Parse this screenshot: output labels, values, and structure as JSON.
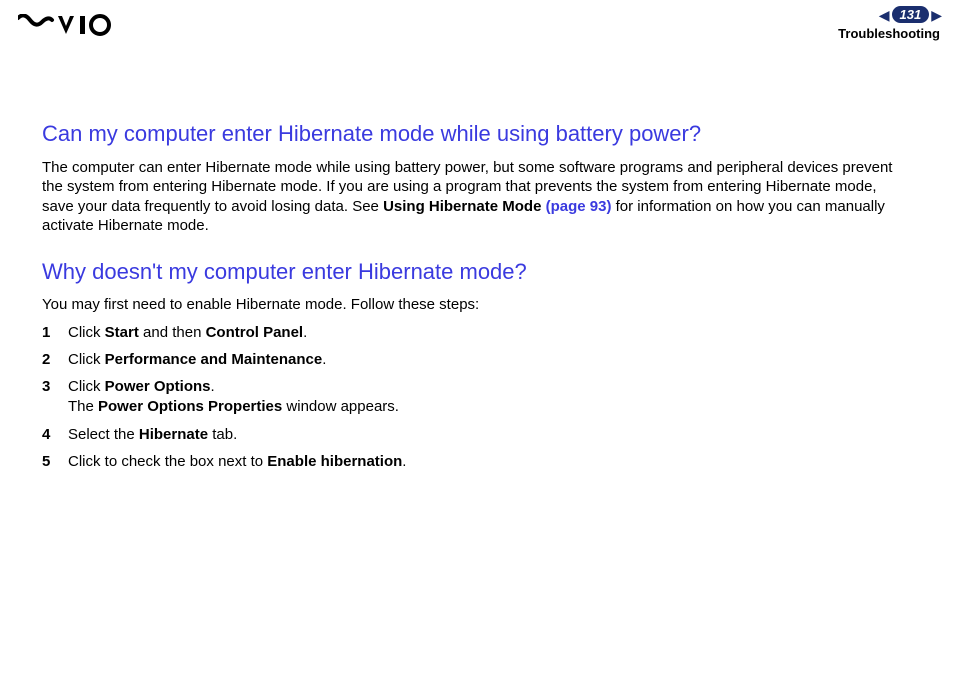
{
  "header": {
    "page_number": "131",
    "section": "Troubleshooting"
  },
  "q1": {
    "title": "Can my computer enter Hibernate mode while using battery power?",
    "body_pre": "The computer can enter Hibernate mode while using battery power, but some software programs and peripheral devices prevent the system from entering Hibernate mode. If you are using a program that prevents the system from entering Hibernate mode, save your data frequently to avoid losing data. See ",
    "body_bold": "Using Hibernate Mode",
    "body_link": " (page 93)",
    "body_post": " for information on how you can manually activate Hibernate mode."
  },
  "q2": {
    "title": "Why doesn't my computer enter Hibernate mode?",
    "intro": "You may first need to enable Hibernate mode. Follow these steps:",
    "steps": [
      {
        "n": "1",
        "pre": "Click ",
        "b1": "Start",
        "mid": " and then ",
        "b2": "Control Panel",
        "post": "."
      },
      {
        "n": "2",
        "pre": "Click ",
        "b1": "Performance and Maintenance",
        "post": "."
      },
      {
        "n": "3",
        "pre": "Click ",
        "b1": "Power Options",
        "post": ".",
        "line2_pre": "The ",
        "line2_b": "Power Options Properties",
        "line2_post": " window appears."
      },
      {
        "n": "4",
        "pre": "Select the ",
        "b1": "Hibernate",
        "post": " tab."
      },
      {
        "n": "5",
        "pre": "Click to check the box next to ",
        "b1": "Enable hibernation",
        "post": "."
      }
    ]
  }
}
